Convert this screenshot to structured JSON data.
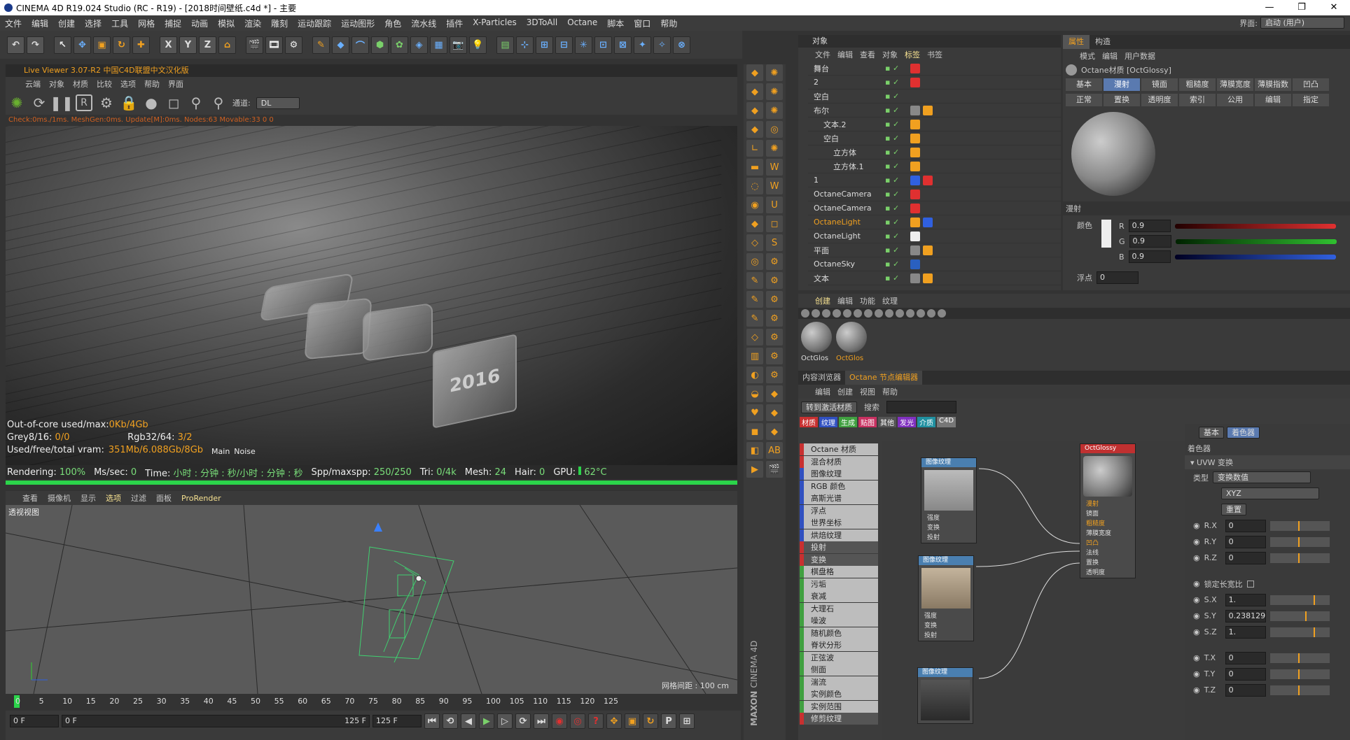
{
  "window": {
    "title": "CINEMA 4D R19.024 Studio (RC - R19) - [2018时间壁纸.c4d *] - 主要"
  },
  "menu": [
    "文件",
    "编辑",
    "创建",
    "选择",
    "工具",
    "网格",
    "捕捉",
    "动画",
    "模拟",
    "渲染",
    "雕刻",
    "运动跟踪",
    "运动图形",
    "角色",
    "流水线",
    "插件",
    "X-Particles",
    "3DToAll",
    "Octane",
    "脚本",
    "窗口",
    "帮助"
  ],
  "interface": {
    "label": "界面:",
    "value": "启动 (用户)"
  },
  "toolbar": {
    "axis": [
      "X",
      "Y",
      "Z"
    ]
  },
  "live_viewer": {
    "title": "Live Viewer 3.07-R2 中国C4D联盟中文汉化版",
    "menu": [
      "云端",
      "对象",
      "材质",
      "比较",
      "选项",
      "帮助",
      "界面"
    ],
    "channel_label": "通道:",
    "channel_value": "DL",
    "status": "Check:0ms./1ms. MeshGen:0ms. Update[M]:0ms. Nodes:63 Movable:33  0 0",
    "info": {
      "ooc_label": "Out-of-core used/max:",
      "ooc_value": "0Kb/4Gb",
      "grey_label": "Grey8/16:",
      "grey_value": "0/0",
      "rgb_label": "Rgb32/64:",
      "rgb_value": "3/2",
      "vram_label": "Used/free/total vram:",
      "vram_value": "351Mb/6.088Gb/8Gb",
      "tab_main": "Main",
      "tab_noise": "Noise"
    },
    "text_2016": "2016",
    "render": {
      "rendering_label": "Rendering:",
      "rendering_value": "100%",
      "ms_label": "Ms/sec:",
      "ms_value": "0",
      "time_label": "Time:",
      "time_value": "小时 : 分钟 : 秒/小时 : 分钟 : 秒",
      "spp_label": "Spp/maxspp:",
      "spp_value": "250/250",
      "tri_label": "Tri:",
      "tri_value": "0/4k",
      "mesh_label": "Mesh:",
      "mesh_value": "24",
      "hair_label": "Hair:",
      "hair_value": "0",
      "gpu_label": "GPU:",
      "gpu_value": "62°C"
    },
    "progress": 1.0
  },
  "viewport": {
    "menu": [
      "查看",
      "摄像机",
      "显示",
      "选项",
      "过滤",
      "面板",
      "ProRender"
    ],
    "label": "透视视图",
    "grid": "网格间距 : 100 cm"
  },
  "timeline": {
    "ticks": [
      "0",
      "5",
      "10",
      "15",
      "20",
      "25",
      "30",
      "35",
      "40",
      "45",
      "50",
      "55",
      "60",
      "65",
      "70",
      "75",
      "80",
      "85",
      "90",
      "95",
      "100",
      "105",
      "110",
      "115",
      "120",
      "125"
    ],
    "frame_right": "0 F",
    "start": "0 F",
    "cur": "0 F",
    "end_small": "125 F",
    "end": "125 F"
  },
  "object_manager": {
    "title": "对象",
    "menu": [
      "文件",
      "编辑",
      "查看",
      "对象",
      "标签",
      "书签"
    ],
    "rows": [
      {
        "name": "舞台",
        "indent": 0
      },
      {
        "name": "2",
        "indent": 0
      },
      {
        "name": "空白",
        "indent": 0
      },
      {
        "name": "布尔",
        "indent": 0
      },
      {
        "name": "文本.2",
        "indent": 1
      },
      {
        "name": "空白",
        "indent": 1
      },
      {
        "name": "立方体",
        "indent": 2
      },
      {
        "name": "立方体.1",
        "indent": 2
      },
      {
        "name": "1",
        "indent": 0
      },
      {
        "name": "OctaneCamera",
        "indent": 0
      },
      {
        "name": "OctaneCamera",
        "indent": 0
      },
      {
        "name": "OctaneLight",
        "indent": 0,
        "selected": true
      },
      {
        "name": "OctaneLight",
        "indent": 0
      },
      {
        "name": "平面",
        "indent": 0
      },
      {
        "name": "OctaneSky",
        "indent": 0
      },
      {
        "name": "文本",
        "indent": 0
      }
    ]
  },
  "attribute_manager": {
    "tabs": [
      "属性",
      "构造"
    ],
    "menu": [
      "模式",
      "编辑",
      "用户数据"
    ],
    "material": "Octane材质 [OctGlossy]",
    "buttons_row1": [
      "基本",
      "漫射",
      "镜面",
      "粗糙度",
      "薄膜宽度",
      "薄膜指数",
      "凹凸"
    ],
    "buttons_row2": [
      "正常",
      "置换",
      "透明度",
      "索引",
      "公用",
      "编辑",
      "指定"
    ],
    "section": "漫射",
    "color_label": "颜色",
    "r_label": "R",
    "r_value": "0.9",
    "g_label": "G",
    "g_value": "0.9",
    "b_label": "B",
    "b_value": "0.9",
    "float_label": "浮点",
    "float_value": "0"
  },
  "material_manager": {
    "menu": [
      "创建",
      "编辑",
      "功能",
      "纹理"
    ],
    "materials": [
      {
        "name": "OctGlos"
      },
      {
        "name": "OctGlos",
        "selected": true
      }
    ]
  },
  "node_editor": {
    "tabs": [
      "内容浏览器",
      "Octane 节点编辑器"
    ],
    "menu": [
      "编辑",
      "创建",
      "视图",
      "帮助"
    ],
    "goto": "转到激活材质",
    "search": "搜索",
    "categories": [
      {
        "t": "材质",
        "c": "#c83030"
      },
      {
        "t": "纹理",
        "c": "#3050c0"
      },
      {
        "t": "生成",
        "c": "#40a040"
      },
      {
        "t": "贴图",
        "c": "#c83060"
      },
      {
        "t": "其他",
        "c": "#555"
      },
      {
        "t": "发光",
        "c": "#8030c0"
      },
      {
        "t": "介质",
        "c": "#2090a0"
      },
      {
        "t": "C4D",
        "c": "#777"
      }
    ],
    "list": [
      {
        "t": "Octane 材质",
        "k": "red"
      },
      {
        "t": "混合材质",
        "k": "red"
      },
      {
        "t": "图像纹理",
        "k": "blu"
      },
      {
        "t": "RGB 颜色",
        "k": "blu"
      },
      {
        "t": "高斯光谱",
        "k": "blu"
      },
      {
        "t": "浮点",
        "k": "blu"
      },
      {
        "t": "世界坐标",
        "k": "blu"
      },
      {
        "t": "烘焙纹理",
        "k": "blu"
      },
      {
        "t": "投射",
        "k": "dk"
      },
      {
        "t": "变换",
        "k": "dk"
      },
      {
        "t": "棋盘格",
        "k": "grn"
      },
      {
        "t": "污垢",
        "k": "grn"
      },
      {
        "t": "衰减",
        "k": "grn"
      },
      {
        "t": "大理石",
        "k": "grn"
      },
      {
        "t": "噪波",
        "k": "grn"
      },
      {
        "t": "随机颜色",
        "k": "grn"
      },
      {
        "t": "脊状分形",
        "k": "grn"
      },
      {
        "t": "正弦波",
        "k": "grn"
      },
      {
        "t": "侧面",
        "k": "grn"
      },
      {
        "t": "湍流",
        "k": "grn"
      },
      {
        "t": "实例颜色",
        "k": "grn"
      },
      {
        "t": "实例范围",
        "k": "grn"
      },
      {
        "t": "修剪纹理",
        "k": "dk"
      }
    ],
    "node_img": "图像纹理",
    "node_ports": [
      "强度",
      "变换",
      "投射"
    ],
    "main_node": "OctGlossy",
    "main_ports": [
      "漫射",
      "镜面",
      "粗糙度",
      "薄膜宽度",
      "凹凸",
      "法线",
      "置换",
      "透明度"
    ],
    "props": {
      "tabs": [
        "基本",
        "着色器"
      ],
      "section": "着色器",
      "uvw": "UVW 变换",
      "type_label": "类型",
      "type_value": "变换数值",
      "order": "XYZ",
      "reset": "重置",
      "rows": [
        {
          "l": "R.X",
          "v": "0"
        },
        {
          "l": "R.Y",
          "v": "0"
        },
        {
          "l": "R.Z",
          "v": "0"
        }
      ],
      "lock": "锁定长宽比",
      "srows": [
        {
          "l": "S.X",
          "v": "1."
        },
        {
          "l": "S.Y",
          "v": "0.238129"
        },
        {
          "l": "S.Z",
          "v": "1."
        }
      ],
      "trows": [
        {
          "l": "T.X",
          "v": "0"
        },
        {
          "l": "T.Y",
          "v": "0"
        },
        {
          "l": "T.Z",
          "v": "0"
        }
      ]
    }
  },
  "brand": {
    "maxon": "MAXON",
    "cinema": "CINEMA 4D"
  },
  "colors": {
    "accent": "#f0a020",
    "progress": "#2bd44a",
    "red": "#e03030",
    "green": "#30c030",
    "blue": "#3060e0"
  }
}
